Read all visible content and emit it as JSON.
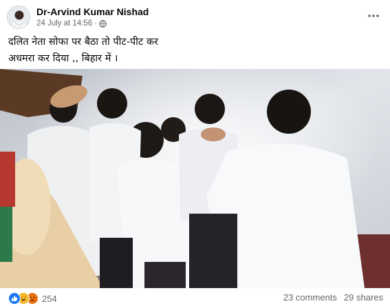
{
  "post": {
    "author": "Dr-Arvind Kumar Nishad",
    "date": "24 July at 14:56",
    "separator": "·",
    "audience_icon": "globe-icon",
    "text_line1": "दलित नेता  सोफा पर बैठा तो  पीट-पीट कर",
    "text_line2": "अधमरा  कर  दिया  ,, बिहार  में  ।"
  },
  "video": {
    "description_icon": "video-thumbnail"
  },
  "footer": {
    "reaction_icons": [
      "like-icon",
      "haha-icon",
      "angry-icon"
    ],
    "reaction_count": "254",
    "comments": "23 comments",
    "shares": "29 shares"
  },
  "colors": {
    "like_blue": "#1877f2",
    "haha_yellow": "#f7b928",
    "angry_orange": "#e9710f",
    "meta_gray": "#65676b"
  }
}
